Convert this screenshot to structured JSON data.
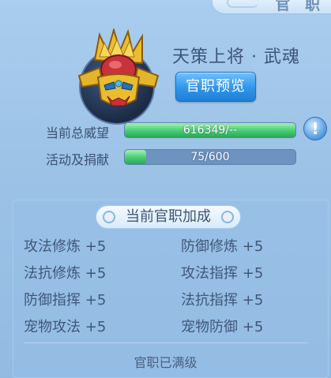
{
  "header": {
    "title_fragment": "官 职"
  },
  "rank": {
    "name": "天策上将 · 武魂",
    "preview_button": "官职预览"
  },
  "stats": [
    {
      "label": "当前总威望",
      "value_text": "616349/--",
      "fill": 1.0
    },
    {
      "label": "活动及捐献",
      "value_text": "75/600",
      "fill": 0.125
    }
  ],
  "info_button": "!",
  "bonus_panel": {
    "title": "当前官职加成",
    "items": [
      {
        "name": "攻法修炼",
        "value": "+5"
      },
      {
        "name": "防御修炼",
        "value": "+5"
      },
      {
        "name": "法抗修炼",
        "value": "+5"
      },
      {
        "name": "攻法指挥",
        "value": "+5"
      },
      {
        "name": "防御指挥",
        "value": "+5"
      },
      {
        "name": "法抗指挥",
        "value": "+5"
      },
      {
        "name": "宠物攻法",
        "value": "+5"
      },
      {
        "name": "宠物防御",
        "value": "+5"
      }
    ],
    "footer": "官职已满级"
  },
  "colors": {
    "background": "#9cc2e6",
    "progress_green": "#4ccf75",
    "button_blue": "#2f95ea",
    "emblem_gold": "#e3b52c",
    "emblem_red": "#c8323a"
  },
  "icons": {
    "emblem": "golden-helmet-emblem-icon",
    "info": "exclamation-info-icon"
  }
}
